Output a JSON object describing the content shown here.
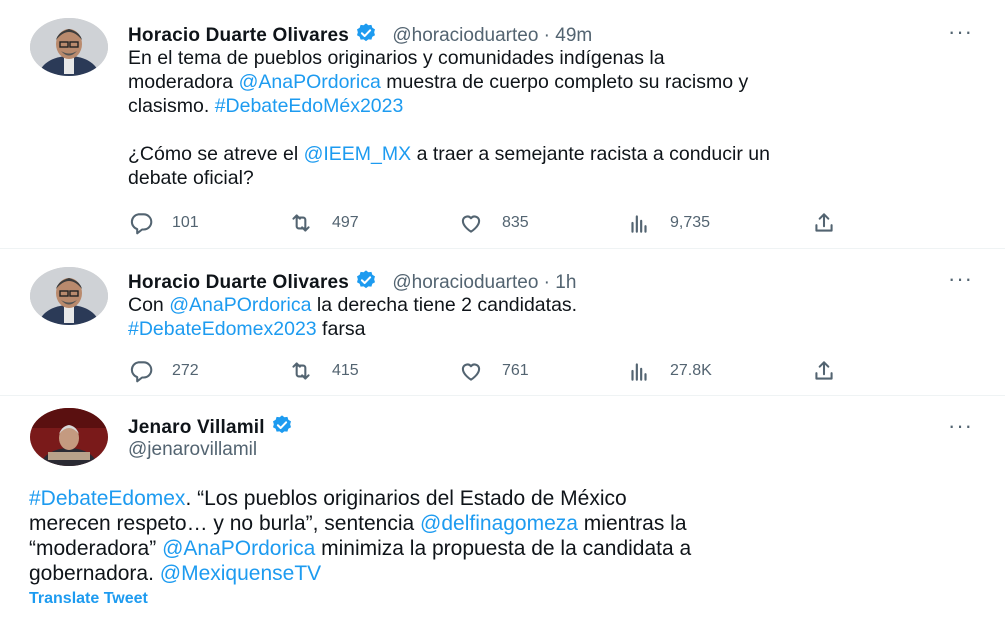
{
  "tweets": [
    {
      "name": "Horacio Duarte Olivares",
      "handle": "@horacioduarteo",
      "time": "49m",
      "lines": [
        [
          {
            "t": "En el tema de pueblos originarios y comunidades indígenas la"
          }
        ],
        [
          {
            "t": "moderadora "
          },
          {
            "t": "@AnaPOrdorica",
            "link": true
          },
          {
            "t": " muestra de cuerpo completo su racismo y"
          }
        ],
        [
          {
            "t": "clasismo. "
          },
          {
            "t": "#DebateEdoMéx2023",
            "link": true
          }
        ],
        [],
        [
          {
            "t": "¿Cómo se atreve el "
          },
          {
            "t": "@IEEM_MX",
            "link": true
          },
          {
            "t": " a traer a semejante racista a conducir un"
          }
        ],
        [
          {
            "t": "debate oficial?"
          }
        ]
      ],
      "stats": {
        "replies": "101",
        "retweets": "497",
        "likes": "835",
        "views": "9,735"
      }
    },
    {
      "name": "Horacio Duarte Olivares",
      "handle": "@horacioduarteo",
      "time": "1h",
      "lines": [
        [
          {
            "t": "Con "
          },
          {
            "t": "@AnaPOrdorica",
            "link": true
          },
          {
            "t": " la derecha tiene 2 candidatas."
          }
        ],
        [
          {
            "t": "#DebateEdomex2023",
            "link": true
          },
          {
            "t": " farsa"
          }
        ]
      ],
      "stats": {
        "replies": "272",
        "retweets": "415",
        "likes": "761",
        "views": "27.8K"
      }
    },
    {
      "name": "Jenaro Villamil",
      "handle": "@jenarovillamil",
      "lines": [
        [
          {
            "t": "#DebateEdomex",
            "link": true
          },
          {
            "t": ". “Los pueblos originarios del Estado de México"
          }
        ],
        [
          {
            "t": "merecen respeto… y no burla”, sentencia "
          },
          {
            "t": "@delfinagomeza",
            "link": true
          },
          {
            "t": " mientras la"
          }
        ],
        [
          {
            "t": "“moderadora” "
          },
          {
            "t": "@AnaPOrdorica",
            "link": true
          },
          {
            "t": " minimiza la propuesta de la candidata a"
          }
        ],
        [
          {
            "t": "gobernadora. "
          },
          {
            "t": "@MexiquenseTV",
            "link": true
          }
        ]
      ],
      "translate_label": "Translate Tweet"
    }
  ],
  "ui": {
    "more_label": "···",
    "separator": " · ",
    "icons": [
      "reply-icon",
      "retweet-icon",
      "like-icon",
      "views-icon",
      "share-icon",
      "verified-badge-icon",
      "more-options-icon"
    ],
    "colors": {
      "link": "#1d9bf0",
      "secondary": "#536471",
      "verified": "#1d9bf0"
    }
  }
}
